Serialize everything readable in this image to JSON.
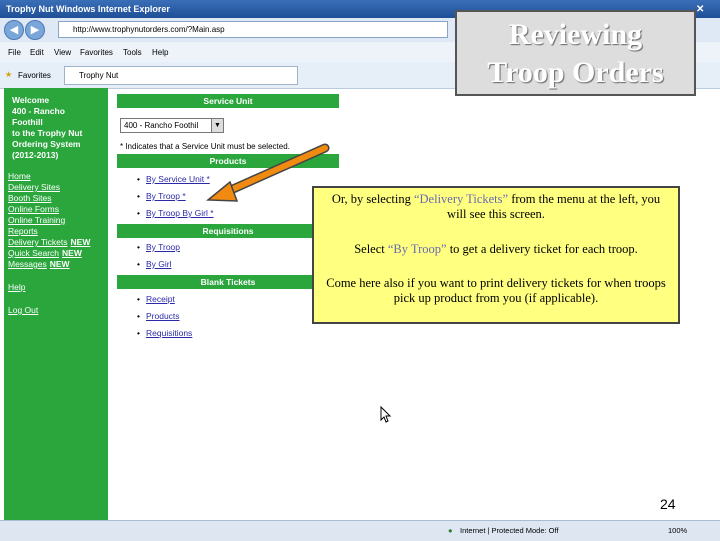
{
  "window": {
    "title": "Trophy Nut   Windows Internet Explorer",
    "address": "http://www.trophynutorders.com/?Main.asp"
  },
  "menubar": {
    "items": [
      "File",
      "Edit",
      "View",
      "Favorites",
      "Tools",
      "Help"
    ]
  },
  "favbar": {
    "favorites_label": "Favorites",
    "tab_label": "Trophy Nut"
  },
  "sidebar": {
    "welcome": [
      "Welcome",
      "400 - Rancho",
      "Foothill",
      "to the Trophy Nut",
      "Ordering System",
      "(2012-2013)"
    ],
    "links": [
      {
        "label": "Home",
        "badge": ""
      },
      {
        "label": "Delivery Sites",
        "badge": ""
      },
      {
        "label": "Booth Sites",
        "badge": ""
      },
      {
        "label": "Online Forms",
        "badge": ""
      },
      {
        "label": "Online Training",
        "badge": ""
      },
      {
        "label": "Reports",
        "badge": ""
      },
      {
        "label": "Delivery Tickets",
        "badge": "NEW"
      },
      {
        "label": "Quick Search",
        "badge": "NEW"
      },
      {
        "label": "Messages",
        "badge": "NEW"
      }
    ],
    "help": "Help",
    "logout": "Log Out"
  },
  "main": {
    "service_unit_header": "Service Unit",
    "service_unit_select": "400 - Rancho Foothil",
    "note": "* Indicates that a Service Unit must be selected.",
    "sections": [
      {
        "header": "Products",
        "items": [
          "By Service Unit *",
          "By Troop *",
          "By Troop By Girl *"
        ]
      },
      {
        "header": "Requisitions",
        "items": [
          "By Troop",
          "By Girl"
        ]
      },
      {
        "header": "Blank Tickets",
        "items": [
          "Receipt",
          "Products",
          "Requisitions"
        ]
      }
    ]
  },
  "statusbar": {
    "zone": "Internet | Protected Mode: Off",
    "zoom": "100%"
  },
  "overlay": {
    "title_line1": "Reviewing",
    "title_line2": "Troop Orders",
    "callout": {
      "p1_pre": "Or, by selecting ",
      "p1_hl": "“Delivery Tickets”",
      "p1_post": " from the menu at the left, you will see this screen.",
      "p2_pre": "Select ",
      "p2_hl": "“By Troop”",
      "p2_post": " to get a delivery ticket for each troop.",
      "p3": "Come here also if you want to print delivery tickets for when troops pick up product from you (if applicable)."
    },
    "page_number": "24",
    "colors": {
      "arrow": "#f08a10",
      "callout_bg": "#ffff80",
      "sidebar_green": "#2aa63c"
    }
  }
}
